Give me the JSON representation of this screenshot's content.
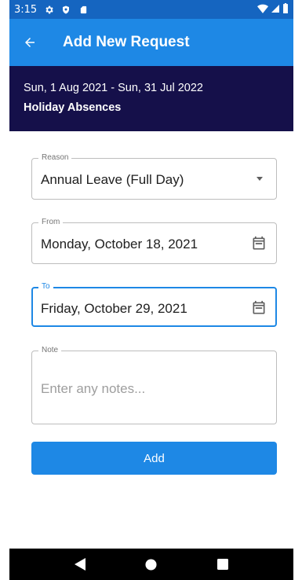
{
  "status_bar": {
    "time": "3:15",
    "icons": [
      "gear-icon",
      "shield-icon",
      "sd-card-icon"
    ],
    "right_icons": [
      "wifi-icon",
      "signal-icon",
      "battery-icon"
    ]
  },
  "app_bar": {
    "back_icon": "arrow-left-icon",
    "title": "Add New Request"
  },
  "header": {
    "period": "Sun, 1 Aug 2021 - Sun, 31 Jul 2022",
    "category": "Holiday Absences"
  },
  "form": {
    "reason": {
      "label": "Reason",
      "value": "Annual Leave (Full Day)"
    },
    "from": {
      "label": "From",
      "value": "Monday, October 18, 2021"
    },
    "to": {
      "label": "To",
      "value": "Friday, October 29, 2021"
    },
    "note": {
      "label": "Note",
      "placeholder": "Enter any notes..."
    },
    "submit_label": "Add"
  },
  "colors": {
    "status_bar": "#1565c0",
    "app_bar": "#1e88e5",
    "header": "#15104a",
    "accent": "#1e88e5"
  },
  "nav_bar": [
    "back-triangle-icon",
    "home-circle-icon",
    "recents-square-icon"
  ]
}
